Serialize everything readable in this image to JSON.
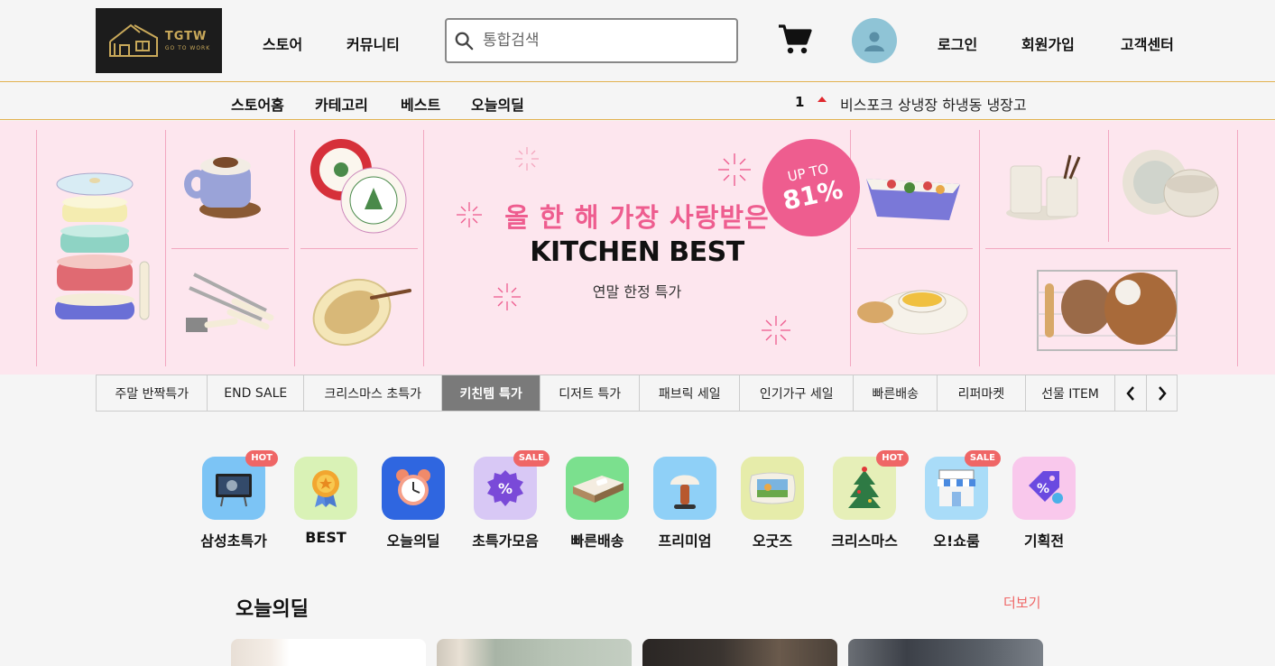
{
  "header": {
    "logo": {
      "title": "TGTW",
      "tagline": "GO TO WORK"
    },
    "nav": [
      "스토어",
      "커뮤니티"
    ],
    "search": {
      "placeholder": "통합검색",
      "value": ""
    },
    "cart_icon": "cart-icon",
    "avatar_icon": "user-icon",
    "links": [
      "로그인",
      "회원가입",
      "고객센터"
    ]
  },
  "subnav": {
    "items": [
      "스토어홈",
      "카테고리",
      "베스트",
      "오늘의딜"
    ],
    "ranking": {
      "rank": "1",
      "trend": "up",
      "text": "비스포크 상냉장 하냉동 냉장고"
    }
  },
  "banner": {
    "headline": "올 한 해 가장 사랑받은",
    "title": "KITCHEN BEST",
    "subtitle": "연말 한정 특가",
    "badge_top": "UP TO",
    "badge_value": "81%",
    "accent": "#ee5d8f",
    "background": "#fde6ee"
  },
  "tabs": {
    "items": [
      "주말 반짝특가",
      "END SALE",
      "크리스마스 초특가",
      "키친템 특가",
      "디저트 특가",
      "패브릭 세일",
      "인기가구 세일",
      "빠른배송",
      "리퍼마켓",
      "선물 ITEM"
    ],
    "active": "키친템 특가",
    "prev_icon": "chevron-left-icon",
    "next_icon": "chevron-right-icon"
  },
  "categories": [
    {
      "label": "삼성초특가",
      "badge": "HOT",
      "icon": "tv-icon",
      "bg": "#7cc4f5"
    },
    {
      "label": "BEST",
      "badge": "",
      "icon": "medal-icon",
      "bg": "#d9f2b6"
    },
    {
      "label": "오늘의딜",
      "badge": "",
      "icon": "alarm-clock-icon",
      "bg": "#2f66e0"
    },
    {
      "label": "초특가모음",
      "badge": "SALE",
      "icon": "discount-icon",
      "bg": "#d8c8f5"
    },
    {
      "label": "빠른배송",
      "badge": "",
      "icon": "bed-icon",
      "bg": "#7be08e"
    },
    {
      "label": "프리미엄",
      "badge": "",
      "icon": "lamp-icon",
      "bg": "#8fd0f7"
    },
    {
      "label": "오굿즈",
      "badge": "",
      "icon": "cushion-icon",
      "bg": "#e6ecaa"
    },
    {
      "label": "크리스마스",
      "badge": "HOT",
      "icon": "christmas-tree-icon",
      "bg": "#e6efb8"
    },
    {
      "label": "오!쇼룸",
      "badge": "SALE",
      "icon": "store-icon",
      "bg": "#a9dcf8"
    },
    {
      "label": "기획전",
      "badge": "",
      "icon": "price-tag-icon",
      "bg": "#f9c8ec"
    }
  ],
  "deals": {
    "title": "오늘의딜",
    "more": "더보기"
  }
}
